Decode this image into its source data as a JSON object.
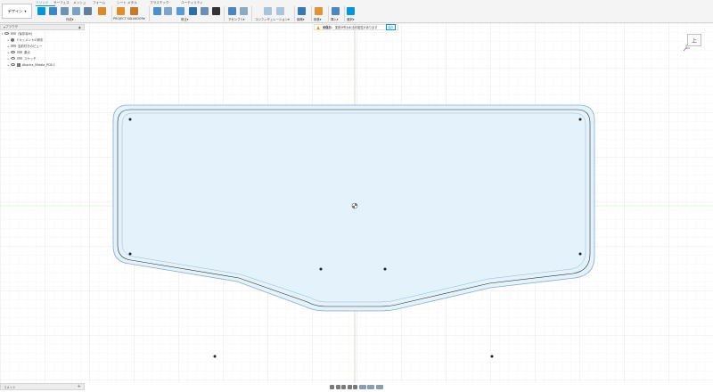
{
  "toolbar": {
    "design_label": "デザイン",
    "tabs": [
      {
        "label": "ソリッド",
        "active": true
      },
      {
        "label": "サーフェス",
        "active": false
      },
      {
        "label": "メッシュ",
        "active": false
      },
      {
        "label": "フォーム",
        "active": false
      },
      {
        "label": "シート メタル",
        "active": false
      },
      {
        "label": "プラスチック",
        "active": false
      },
      {
        "label": "ユーティリティ",
        "active": false
      }
    ],
    "groups": [
      "作成",
      "PROJECT SALVADOR",
      "修正",
      "アセンブリ",
      "コンフィギュレーション",
      "構築",
      "検査",
      "挿入",
      "選択"
    ]
  },
  "browser": {
    "title": "ブラウザ",
    "root": "(保存済み)",
    "items": [
      {
        "label": "ドキュメントの設定"
      },
      {
        "label": "名前付きのビュー"
      },
      {
        "label": "原点"
      },
      {
        "label": "スケッチ"
      },
      {
        "label": "Akacha_Middle_PCB 1"
      }
    ]
  },
  "warning": {
    "label": "未保存:",
    "message": "変更が失われる可能性があります",
    "button": "保存"
  },
  "viewcube": {
    "label": "上"
  },
  "comments": {
    "label": "コメント"
  },
  "colors": {
    "accent": "#0696d7",
    "plate_fill": "#e4f2fb",
    "plate_stroke": "#4e87a8",
    "grid": "#e9e9e9",
    "warning": "#f0a000"
  }
}
